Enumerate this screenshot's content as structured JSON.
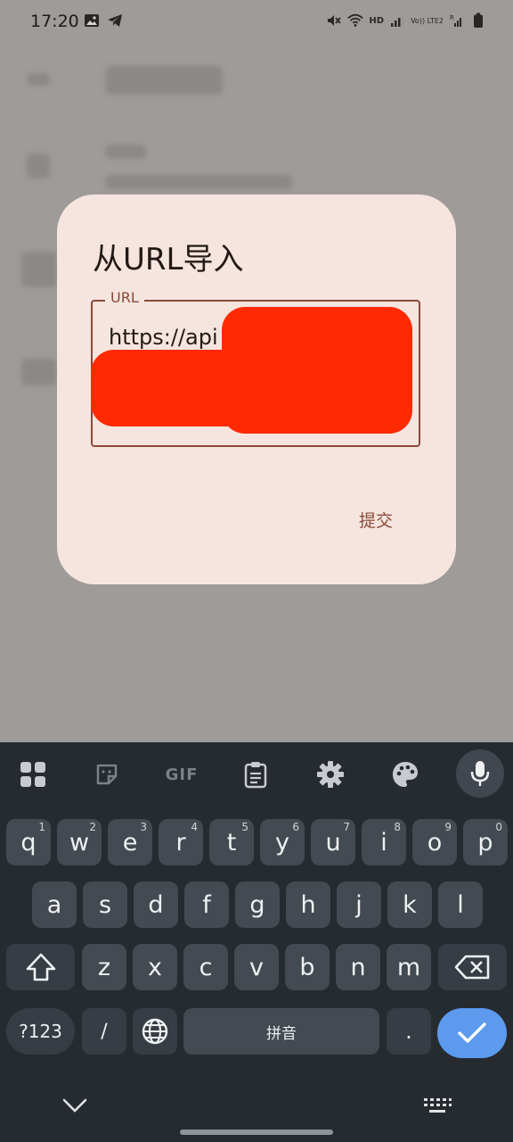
{
  "status_bar": {
    "time": "17:20",
    "left_icons": [
      "image-icon",
      "telegram-icon"
    ],
    "right_icons": [
      "mute-icon",
      "wifi-icon",
      "hd-icon",
      "signal-icon",
      "volte-icon",
      "signal-roaming-icon",
      "battery-icon"
    ],
    "hd_text": "HD",
    "volte_text": "Vo)) LTE2",
    "roaming_text": "R"
  },
  "dialog": {
    "title": "从URL导入",
    "url_label": "URL",
    "url_value": "https://api",
    "submit_label": "提交",
    "accent_color": "#8a4a38",
    "redaction_color": "#ff2a00"
  },
  "keyboard": {
    "toolbar": [
      "apps-grid-icon",
      "sticker-icon",
      "gif-icon",
      "clipboard-icon",
      "settings-gear-icon",
      "palette-icon",
      "mic-icon"
    ],
    "gif_label": "GIF",
    "row1": [
      {
        "k": "q",
        "h": "1"
      },
      {
        "k": "w",
        "h": "2"
      },
      {
        "k": "e",
        "h": "3"
      },
      {
        "k": "r",
        "h": "4"
      },
      {
        "k": "t",
        "h": "5"
      },
      {
        "k": "y",
        "h": "6"
      },
      {
        "k": "u",
        "h": "7"
      },
      {
        "k": "i",
        "h": "8"
      },
      {
        "k": "o",
        "h": "9"
      },
      {
        "k": "p",
        "h": "0"
      }
    ],
    "row2": [
      "a",
      "s",
      "d",
      "f",
      "g",
      "h",
      "j",
      "k",
      "l"
    ],
    "row3": [
      "z",
      "x",
      "c",
      "v",
      "b",
      "n",
      "m"
    ],
    "symbols_label": "?123",
    "slash_label": "/",
    "space_label": "拼音",
    "period_label": ".",
    "enter_color": "#5c9aee"
  }
}
